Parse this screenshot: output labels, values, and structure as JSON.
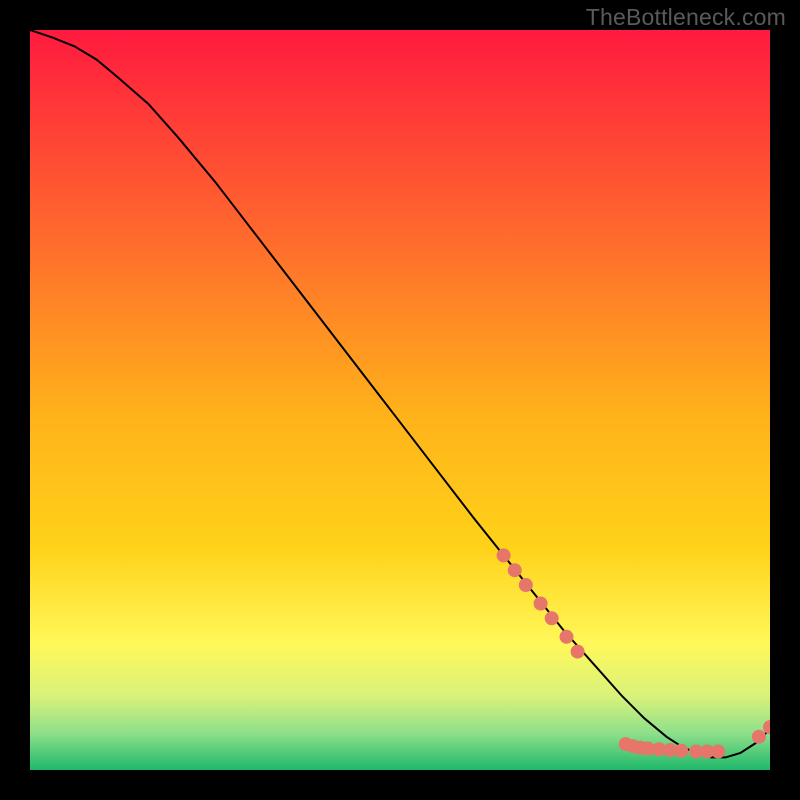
{
  "watermark": "TheBottleneck.com",
  "colors": {
    "background": "#000000",
    "curve": "#000000",
    "marker_fill": "#e6756a",
    "marker_stroke": "#b84d42",
    "grad_top": "#ff1a3f",
    "grad_mid1": "#ff7a2d",
    "grad_mid2": "#ffd21a",
    "grad_mid3": "#fff35a",
    "grad_low1": "#d9f27a",
    "grad_low2": "#8ee08a",
    "grad_bottom": "#1fb86b"
  },
  "chart_data": {
    "type": "line",
    "title": "",
    "xlabel": "",
    "ylabel": "",
    "xlim": [
      0,
      100
    ],
    "ylim": [
      0,
      100
    ],
    "curve": {
      "x": [
        0,
        3,
        6,
        9,
        12,
        16,
        20,
        25,
        30,
        35,
        40,
        45,
        50,
        55,
        60,
        64,
        68,
        72,
        76,
        80,
        83,
        86,
        88,
        90,
        92,
        94,
        96,
        98,
        100
      ],
      "y": [
        100,
        99,
        97.8,
        96,
        93.5,
        90,
        85.5,
        79.5,
        73,
        66.5,
        60,
        53.5,
        47,
        40.5,
        34,
        29,
        24,
        19,
        14.5,
        10,
        7,
        4.5,
        3.2,
        2.3,
        1.7,
        1.7,
        2.3,
        3.6,
        5.5
      ]
    },
    "markers": [
      {
        "x": 64,
        "y": 29
      },
      {
        "x": 65.5,
        "y": 27
      },
      {
        "x": 67,
        "y": 25
      },
      {
        "x": 69,
        "y": 22.5
      },
      {
        "x": 70.5,
        "y": 20.5
      },
      {
        "x": 72.5,
        "y": 18
      },
      {
        "x": 74,
        "y": 16
      },
      {
        "x": 80.5,
        "y": 3.5
      },
      {
        "x": 81.5,
        "y": 3.2
      },
      {
        "x": 82.5,
        "y": 3
      },
      {
        "x": 83.5,
        "y": 2.9
      },
      {
        "x": 85,
        "y": 2.8
      },
      {
        "x": 86.5,
        "y": 2.7
      },
      {
        "x": 88,
        "y": 2.6
      },
      {
        "x": 90,
        "y": 2.5
      },
      {
        "x": 91.5,
        "y": 2.5
      },
      {
        "x": 93,
        "y": 2.5
      },
      {
        "x": 98.5,
        "y": 4.5
      },
      {
        "x": 100,
        "y": 5.8
      }
    ]
  }
}
